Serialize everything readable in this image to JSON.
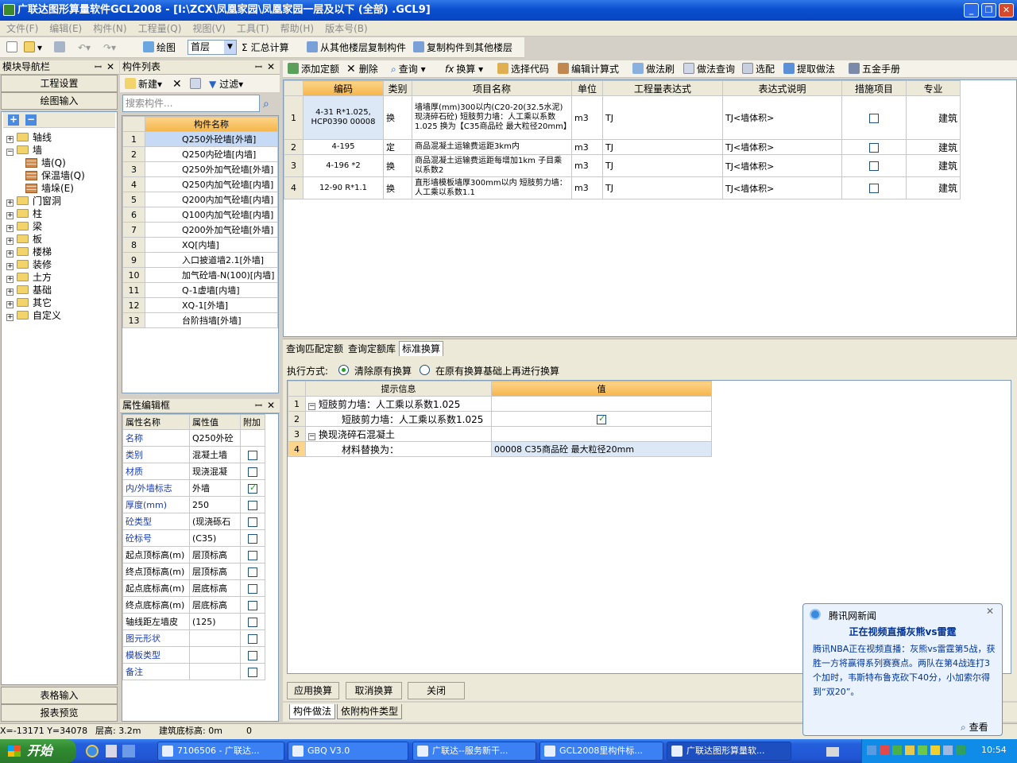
{
  "window": {
    "title": "广联达图形算量软件GCL2008 - [I:\\ZCX\\凤凰家园\\凤凰家园一层及以下 (全部) .GCL9]"
  },
  "menu": [
    "文件(F)",
    "编辑(E)",
    "构件(N)",
    "工程量(Q)",
    "视图(V)",
    "工具(T)",
    "帮助(H)",
    "版本号(B)"
  ],
  "toolbar1": {
    "draw": "绘图",
    "floor": "首层",
    "sum": "汇总计算",
    "copy_from": "从其他楼层复制构件",
    "copy_to": "复制构件到其他楼层"
  },
  "module_nav": {
    "title": "模块导航栏",
    "project_settings": "工程设置",
    "draw_input": "绘图输入",
    "table_input": "表格输入",
    "report_preview": "报表预览",
    "tree": [
      {
        "label": "轴线",
        "level": 0,
        "expanded": false
      },
      {
        "label": "墙",
        "level": 0,
        "expanded": true
      },
      {
        "label": "墙(Q)",
        "level": 1,
        "icon": "wall-icon"
      },
      {
        "label": "保温墙(Q)",
        "level": 1,
        "icon": "insulation-wall-icon"
      },
      {
        "label": "墙垛(E)",
        "level": 1,
        "icon": "wall-pier-icon"
      },
      {
        "label": "门窗洞",
        "level": 0,
        "expanded": false
      },
      {
        "label": "柱",
        "level": 0,
        "expanded": false
      },
      {
        "label": "梁",
        "level": 0,
        "expanded": false
      },
      {
        "label": "板",
        "level": 0,
        "expanded": false
      },
      {
        "label": "楼梯",
        "level": 0,
        "expanded": false
      },
      {
        "label": "装修",
        "level": 0,
        "expanded": false
      },
      {
        "label": "土方",
        "level": 0,
        "expanded": false
      },
      {
        "label": "基础",
        "level": 0,
        "expanded": false
      },
      {
        "label": "其它",
        "level": 0,
        "expanded": false
      },
      {
        "label": "自定义",
        "level": 0,
        "expanded": false
      }
    ]
  },
  "component_list": {
    "title": "构件列表",
    "new": "新建",
    "filter": "过滤",
    "search_placeholder": "搜索构件...",
    "col_name": "构件名称",
    "rows": [
      {
        "n": "1",
        "name": "Q250外砼墙[外墙]"
      },
      {
        "n": "2",
        "name": "Q250内砼墙[内墙]"
      },
      {
        "n": "3",
        "name": "Q250外加气砼墙[外墙]"
      },
      {
        "n": "4",
        "name": "Q250内加气砼墙[内墙]"
      },
      {
        "n": "5",
        "name": "Q200内加气砼墙[内墙]"
      },
      {
        "n": "6",
        "name": "Q100内加气砼墙[内墙]"
      },
      {
        "n": "7",
        "name": "Q200外加气砼墙[外墙]"
      },
      {
        "n": "8",
        "name": "XQ[内墙]"
      },
      {
        "n": "9",
        "name": "入口披道墙2.1[外墙]"
      },
      {
        "n": "10",
        "name": "加气砼墙-N(100)[内墙]"
      },
      {
        "n": "11",
        "name": "Q-1虚墙[内墙]"
      },
      {
        "n": "12",
        "name": "XQ-1[外墙]"
      },
      {
        "n": "13",
        "name": "台阶挡墙[外墙]"
      }
    ]
  },
  "props": {
    "title": "属性编辑框",
    "col_name": "属性名称",
    "col_value": "属性值",
    "col_add": "附加",
    "rows": [
      {
        "name": "名称",
        "value": "Q250外砼",
        "blue": true,
        "cb": null
      },
      {
        "name": "类别",
        "value": "混凝土墙",
        "blue": true,
        "cb": false
      },
      {
        "name": "材质",
        "value": "现浇混凝",
        "blue": true,
        "cb": false
      },
      {
        "name": "内/外墙标志",
        "value": "外墙",
        "blue": true,
        "cb": true
      },
      {
        "name": "厚度(mm)",
        "value": "250",
        "blue": true,
        "cb": false
      },
      {
        "name": "砼类型",
        "value": "(现浇砾石",
        "blue": true,
        "cb": false
      },
      {
        "name": "砼标号",
        "value": "(C35)",
        "blue": true,
        "cb": false
      },
      {
        "name": "起点顶标高(m)",
        "value": "层顶标高",
        "blue": false,
        "cb": false
      },
      {
        "name": "终点顶标高(m)",
        "value": "层顶标高",
        "blue": false,
        "cb": false
      },
      {
        "name": "起点底标高(m)",
        "value": "层底标高",
        "blue": false,
        "cb": false
      },
      {
        "name": "终点底标高(m)",
        "value": "层底标高",
        "blue": false,
        "cb": false
      },
      {
        "name": "轴线距左墙皮",
        "value": "(125)",
        "blue": false,
        "cb": false
      },
      {
        "name": "图元形状",
        "value": "",
        "blue": true,
        "cb": false
      },
      {
        "name": "模板类型",
        "value": "",
        "blue": true,
        "cb": false
      },
      {
        "name": "备注",
        "value": "",
        "blue": true,
        "cb": false
      }
    ]
  },
  "toolbar2": {
    "add_quota": "添加定额",
    "delete": "删除",
    "query": "查询",
    "replace": "换算",
    "select_code": "选择代码",
    "edit_formula": "编辑计算式",
    "method_brush": "做法刷",
    "method_query": "做法查询",
    "select_match": "选配",
    "extract_method": "提取做法",
    "hardware_manual": "五金手册"
  },
  "quota_table": {
    "headers": [
      "编码",
      "类别",
      "项目名称",
      "单位",
      "工程量表达式",
      "表达式说明",
      "措施项目",
      "专业"
    ],
    "rows": [
      {
        "n": "1",
        "code": "4-31 R*1.025, HCP0390 00008",
        "type": "换",
        "name": "墙墙厚(mm)300以内(C20-20(32.5水泥)现浇碎石砼) 短肢剪力墙：人工乘以系数1.025 换为【C35商品砼 最大粒径20mm】",
        "unit": "m3",
        "expr": "TJ",
        "desc": "TJ<墙体积>",
        "measure": false,
        "major": "建筑"
      },
      {
        "n": "2",
        "code": "4-195",
        "type": "定",
        "name": "商品混凝土运输费运距3km内",
        "unit": "m3",
        "expr": "TJ",
        "desc": "TJ<墙体积>",
        "measure": false,
        "major": "建筑"
      },
      {
        "n": "3",
        "code": "4-196 *2",
        "type": "换",
        "name": "商品混凝土运输费运距每增加1km 子目乘以系数2",
        "unit": "m3",
        "expr": "TJ",
        "desc": "TJ<墙体积>",
        "measure": false,
        "major": "建筑"
      },
      {
        "n": "4",
        "code": "12-90 R*1.1",
        "type": "换",
        "name": "直形墙模板墙厚300mm以内 短肢剪力墙：人工乘以系数1.1",
        "unit": "m3",
        "expr": "TJ",
        "desc": "TJ<墙体积>",
        "measure": false,
        "major": "建筑"
      }
    ]
  },
  "bottom": {
    "tabs": [
      "查询匹配定额",
      "查询定额库",
      "标准换算"
    ],
    "exec_label": "执行方式:",
    "opt1": "清除原有换算",
    "opt2": "在原有换算基础上再进行换算",
    "col_hint": "提示信息",
    "col_value": "值",
    "rows": [
      {
        "n": "1",
        "text": "短肢剪力墙：人工乘以系数1.025",
        "value": "",
        "level": 0,
        "cb": null
      },
      {
        "n": "2",
        "text": "短肢剪力墙：人工乘以系数1.025",
        "value": "",
        "level": 1,
        "cb": true
      },
      {
        "n": "3",
        "text": "换现浇碎石混凝土",
        "value": "",
        "level": 0,
        "cb": null
      },
      {
        "n": "4",
        "text": "材料替换为：",
        "value": "00008  C35商品砼  最大粒径20mm",
        "level": 1,
        "cb": null
      }
    ],
    "apply": "应用换算",
    "cancel": "取消换算",
    "close": "关闭",
    "tab_method": "构件做法",
    "tab_attached": "依附构件类型"
  },
  "status": {
    "coords": "X=-13171 Y=34078",
    "floor_height": "层高: 3.2m",
    "base_elev": "建筑底标高: 0m",
    "zero": "0"
  },
  "popup": {
    "title": "腾讯网新闻",
    "headline": "正在视频直播灰熊vs雷霆",
    "body": "腾讯NBA正在视频直播：灰熊vs雷霆第5战，获胜一方将赢得系列赛赛点。两队在第4战连打3个加时，韦斯特布鲁克砍下40分，小加索尔得到“双20”。",
    "view": "查看"
  },
  "taskbar": {
    "start": "开始",
    "tasks": [
      "7106506 - 广联达...",
      "GBQ V3.0",
      "广联达--服务新干...",
      "GCL2008里构件标...",
      "广联达图形算量软..."
    ],
    "time": "10:54"
  }
}
